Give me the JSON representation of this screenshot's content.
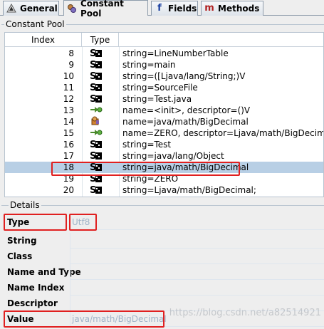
{
  "tabs": [
    {
      "label": "General",
      "icon": "general-icon"
    },
    {
      "label": "Constant Pool",
      "icon": "constant-pool-icon"
    },
    {
      "label": "Fields",
      "icon": "fields-icon"
    },
    {
      "label": "Methods",
      "icon": "methods-icon"
    }
  ],
  "constant_pool": {
    "title": "Constant Pool",
    "headers": {
      "index": "Index",
      "type": "Type"
    },
    "rows": [
      {
        "index": "8",
        "type": "string-icon",
        "value": "string=LineNumberTable"
      },
      {
        "index": "9",
        "type": "string-icon",
        "value": "string=main"
      },
      {
        "index": "10",
        "type": "string-icon",
        "value": "string=([Ljava/lang/String;)V"
      },
      {
        "index": "11",
        "type": "string-icon",
        "value": "string=SourceFile"
      },
      {
        "index": "12",
        "type": "string-icon",
        "value": "string=Test.java"
      },
      {
        "index": "13",
        "type": "name-type-icon",
        "value": "name=<init>, descriptor=()V"
      },
      {
        "index": "14",
        "type": "class-icon",
        "value": "name=java/math/BigDecimal"
      },
      {
        "index": "15",
        "type": "name-type-icon",
        "value": "name=ZERO, descriptor=Ljava/math/BigDecimal;"
      },
      {
        "index": "16",
        "type": "string-icon",
        "value": "string=Test"
      },
      {
        "index": "17",
        "type": "string-icon",
        "value": "string=java/lang/Object"
      },
      {
        "index": "18",
        "type": "string-icon",
        "value": "string=java/math/BigDecimal",
        "selected": true
      },
      {
        "index": "19",
        "type": "string-icon",
        "value": "string=ZERO"
      },
      {
        "index": "20",
        "type": "string-icon",
        "value": "string=Ljava/math/BigDecimal;"
      }
    ]
  },
  "details": {
    "title": "Details",
    "fields": [
      {
        "label": "Type",
        "value": "Utf8"
      },
      {
        "label": "String",
        "value": ""
      },
      {
        "label": "Class",
        "value": ""
      },
      {
        "label": "Name and Type",
        "value": ""
      },
      {
        "label": "Name Index",
        "value": ""
      },
      {
        "label": "Descriptor",
        "value": ""
      },
      {
        "label": "Value",
        "value": "java/math/BigDecimal"
      }
    ]
  },
  "watermark": "https://blog.csdn.net/a82514921",
  "colors": {
    "selection": "#b8cfe5",
    "highlight_box": "#e02020",
    "field_value": "#a0b4c8"
  }
}
